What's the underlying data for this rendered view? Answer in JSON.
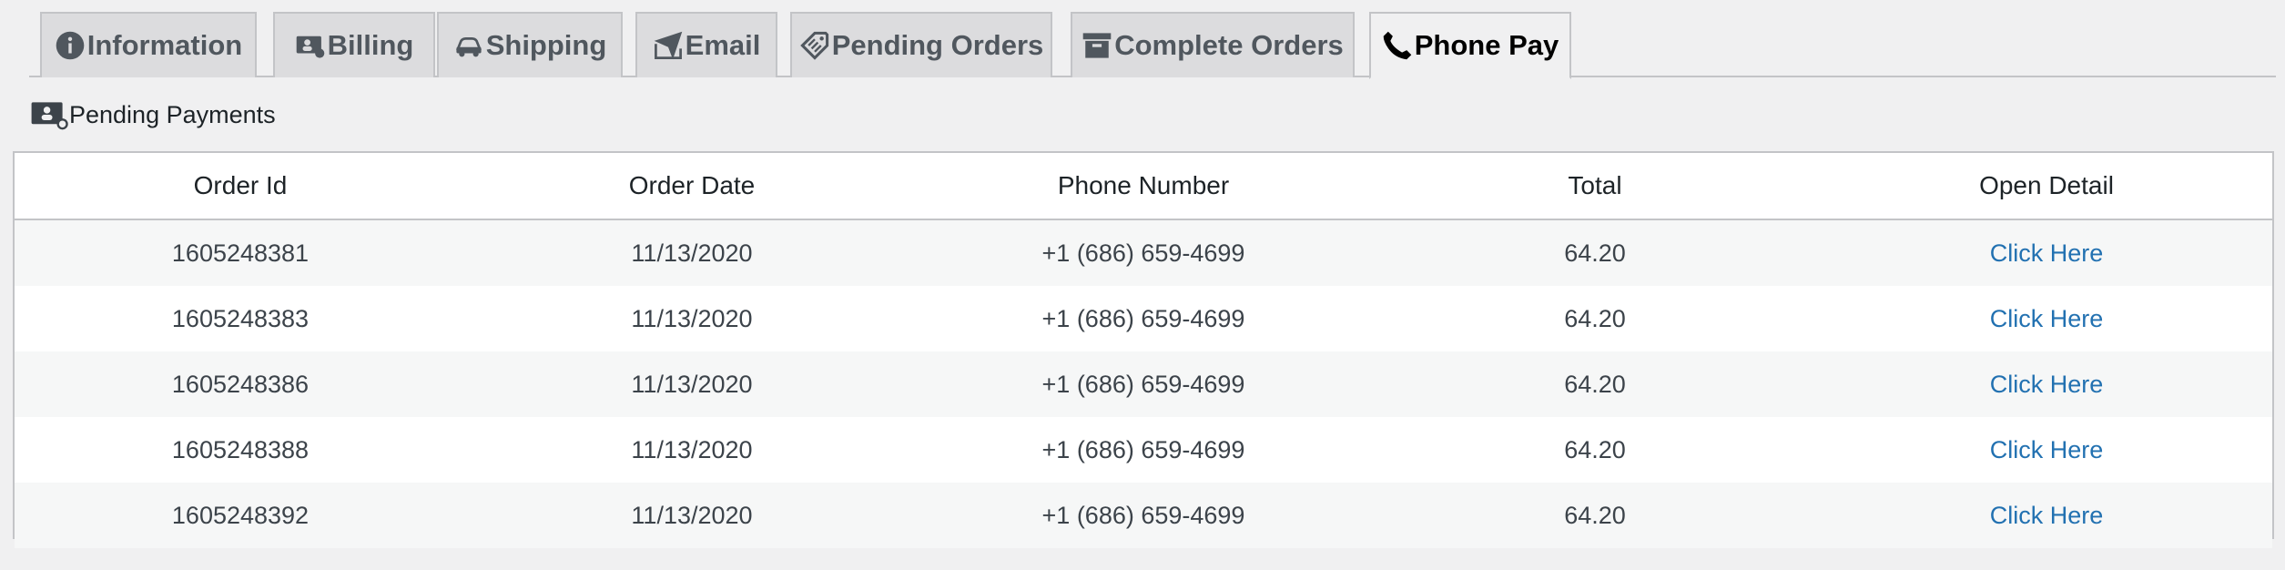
{
  "tabs": [
    {
      "id": "information",
      "label": "Information",
      "icon": "info-icon",
      "active": false
    },
    {
      "id": "billing",
      "label": "Billing",
      "icon": "billing-icon",
      "active": false
    },
    {
      "id": "shipping",
      "label": "Shipping",
      "icon": "car-icon",
      "active": false
    },
    {
      "id": "email",
      "label": "Email",
      "icon": "email-icon",
      "active": false
    },
    {
      "id": "pending-orders",
      "label": "Pending Orders",
      "icon": "tag-icon",
      "active": false
    },
    {
      "id": "complete-orders",
      "label": "Complete Orders",
      "icon": "archive-icon",
      "active": false
    },
    {
      "id": "phone-pay",
      "label": "Phone Pay",
      "icon": "phone-icon",
      "active": true
    }
  ],
  "section": {
    "title": "Pending Payments",
    "icon": "pending-payments-icon"
  },
  "table": {
    "columns": [
      "Order Id",
      "Order Date",
      "Phone Number",
      "Total",
      "Open Detail"
    ],
    "rows": [
      {
        "order_id": "1605248381",
        "order_date": "11/13/2020",
        "phone": "+1 (686) 659-4699",
        "total": "64.20",
        "detail": "Click Here"
      },
      {
        "order_id": "1605248383",
        "order_date": "11/13/2020",
        "phone": "+1 (686) 659-4699",
        "total": "64.20",
        "detail": "Click Here"
      },
      {
        "order_id": "1605248386",
        "order_date": "11/13/2020",
        "phone": "+1 (686) 659-4699",
        "total": "64.20",
        "detail": "Click Here"
      },
      {
        "order_id": "1605248388",
        "order_date": "11/13/2020",
        "phone": "+1 (686) 659-4699",
        "total": "64.20",
        "detail": "Click Here"
      },
      {
        "order_id": "1605248392",
        "order_date": "11/13/2020",
        "phone": "+1 (686) 659-4699",
        "total": "64.20",
        "detail": "Click Here"
      }
    ]
  },
  "colors": {
    "link": "#2271b1",
    "border": "#c3c4c7",
    "tab_bg": "#dcdcde",
    "page_bg": "#f0f0f1"
  }
}
